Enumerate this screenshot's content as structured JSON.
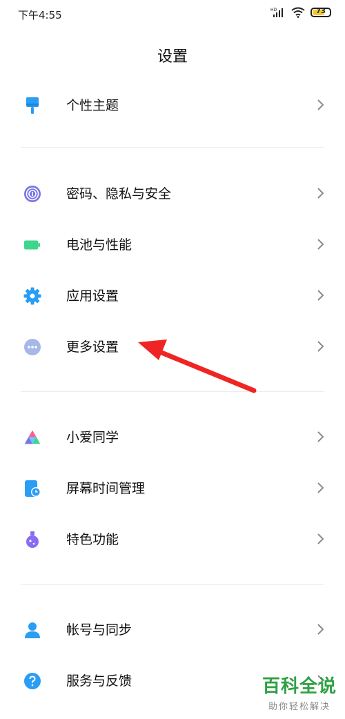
{
  "status_bar": {
    "time": "下午4:55",
    "battery_level": "73",
    "battery_color": "#f7c82e",
    "icons": [
      "hd-signal-icon",
      "wifi-icon",
      "battery-icon"
    ]
  },
  "page": {
    "title": "设置"
  },
  "sections": [
    [
      {
        "label": "个性主题",
        "icon": "paint-brush-icon",
        "color": "#2a9df4"
      }
    ],
    [
      {
        "label": "密码、隐私与安全",
        "icon": "fingerprint-icon",
        "color": "#7b74e8"
      },
      {
        "label": "电池与性能",
        "icon": "battery-icon",
        "color": "#3dd68c"
      },
      {
        "label": "应用设置",
        "icon": "gear-icon",
        "color": "#2a9df4"
      },
      {
        "label": "更多设置",
        "icon": "more-dots-icon",
        "color": "#a7b7e8"
      }
    ],
    [
      {
        "label": "小爱同学",
        "icon": "xiaoai-icon",
        "color": "#ff5c8a"
      },
      {
        "label": "屏幕时间管理",
        "icon": "screen-time-icon",
        "color": "#2a9df4"
      },
      {
        "label": "特色功能",
        "icon": "flask-icon",
        "color": "#8a6cf0"
      }
    ],
    [
      {
        "label": "帐号与同步",
        "icon": "user-icon",
        "color": "#2a9df4"
      },
      {
        "label": "服务与反馈",
        "icon": "help-icon",
        "color": "#2a9df4"
      }
    ]
  ],
  "annotation": {
    "color": "#ef2525",
    "points_to": "更多设置"
  },
  "watermark": {
    "title": "百科全说",
    "subtitle": "助你轻松解决"
  }
}
